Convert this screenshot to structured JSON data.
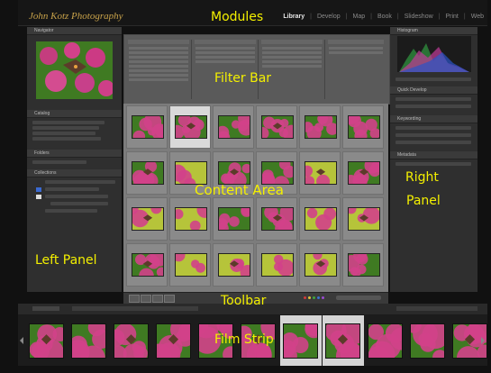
{
  "app": {
    "identity_plate": "John Kotz Photography"
  },
  "modules": {
    "items": [
      "Library",
      "Develop",
      "Map",
      "Book",
      "Slideshow",
      "Print",
      "Web"
    ],
    "active": "Library"
  },
  "overlay_labels": {
    "modules": "Modules",
    "filter_bar": "Filter Bar",
    "content_area": "Content Area",
    "right_panel_line1": "Right",
    "right_panel_line2": "Panel",
    "left_panel": "Left Panel",
    "toolbar": "Toolbar",
    "film_strip": "Film Strip"
  },
  "grid": {
    "columns": 6,
    "rows": 4,
    "selected_cells": [
      1
    ]
  },
  "filmstrip": {
    "count": 11,
    "selected_index": 6
  },
  "colors": {
    "label_text": "#f4f000",
    "identity_plate": "#c8a24a",
    "flower_pink": "#d2418a",
    "leaf_green": "#3f7a22",
    "yellow_green": "#b6c43a"
  },
  "color_labels": [
    "#d23a3a",
    "#e0c23a",
    "#3fa63f",
    "#3a72d2",
    "#9a4ad2"
  ]
}
